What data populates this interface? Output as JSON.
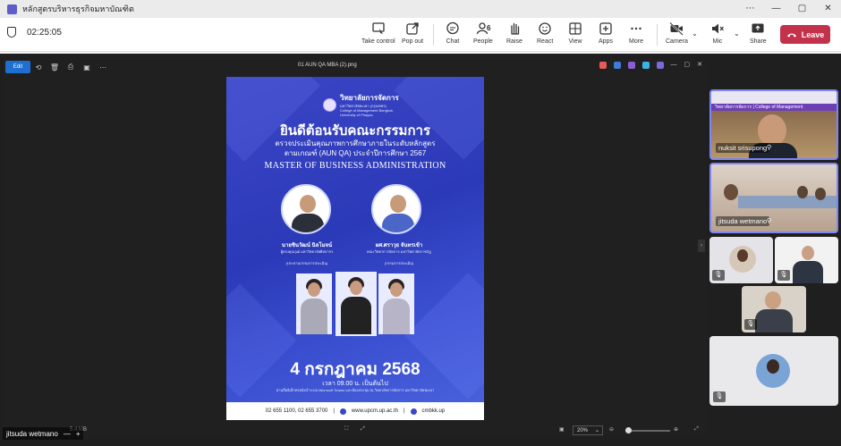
{
  "window": {
    "title": "หลักสูตรบริหารธุรกิจมหาบัณฑิต",
    "controls": [
      "⋯",
      "—",
      "▢",
      "✕"
    ]
  },
  "toolbar": {
    "timer": "02:25:05",
    "buttons": [
      {
        "id": "take-control",
        "label": "Take control",
        "icon": "take-control-icon"
      },
      {
        "id": "pop-out",
        "label": "Pop out",
        "icon": "pop-out-icon"
      },
      {
        "id": "chat",
        "label": "Chat",
        "icon": "chat-icon"
      },
      {
        "id": "people",
        "label": "People",
        "icon": "people-icon",
        "badge": "6"
      },
      {
        "id": "raise",
        "label": "Raise",
        "icon": "hand-icon"
      },
      {
        "id": "react",
        "label": "React",
        "icon": "smile-icon"
      },
      {
        "id": "view",
        "label": "View",
        "icon": "grid-icon"
      },
      {
        "id": "apps",
        "label": "Apps",
        "icon": "plus-square-icon"
      },
      {
        "id": "more",
        "label": "More",
        "icon": "ellipsis-icon"
      },
      {
        "id": "camera",
        "label": "Camera",
        "icon": "camera-off-icon"
      },
      {
        "id": "mic",
        "label": "Mic",
        "icon": "mic-muted-icon"
      },
      {
        "id": "share",
        "label": "Share",
        "icon": "share-icon"
      }
    ],
    "leave_label": "Leave"
  },
  "viewer": {
    "edit_label": "Edit",
    "file_name": "01 AUN QA MBA (2).png",
    "zoom": "20%",
    "file_size": "5.4 MB"
  },
  "poster": {
    "college_th": "วิทยาลัยการจัดการ",
    "college_sub": "มหาวิทยาลัยพะเยา (กรุงเทพฯ)",
    "college_en1": "College of Management Bangkok",
    "college_en2": "University of Phayao",
    "welcome": "ยินดีต้อนรับคณะกรรมการ",
    "sub1": "ตรวจประเมินคุณภาพการศึกษาภายในระดับหลักสูตร",
    "sub2": "ตามเกณฑ์ (AUN QA) ประจำปีการศึกษา 2567",
    "program": "MASTER OF BUSINESS ADMINISTRATION",
    "person1_name": "นายชินวัฒน์ นิลโมจน์",
    "person1_role": "ผู้ทรงคุณวุฒิ มหาวิทยาลัยศิลปากร",
    "person1_title": "(ประธานกรรมการประเมิน)",
    "person2_name": "ผศ.ศราวุธ จันทรเข้า",
    "person2_role": "คณะวิทยาการจัดการ มหาวิทยาลัยราชภัฏ",
    "person2_title": "(กรรมการประเมิน)",
    "date": "4 กรกฎาคม 2568",
    "time": "เวลา 09.00 น. เป็นต้นไป",
    "via": "ผ่านสื่ออิเล็กทรอนิกส์ ระบบ Microsoft Teams และห้องประชุม ณ วิทยาลัยการจัดการ มหาวิทยาลัยพะเยา",
    "phone": "02 655 1100, 02 655 3700",
    "web": "www.upcm.up.ac.th",
    "fb": "cmbkk.up"
  },
  "sharer": "jitsuda wetmano",
  "participants": [
    {
      "name": "nuksit srisupong",
      "banner": "วิทยาลัยการจัดการ | College of Management"
    },
    {
      "name": "jitsuda wetmano"
    }
  ],
  "colors": {
    "accent": "#5b5fc7",
    "leave": "#c4314b",
    "poster": "#2b3ab8"
  }
}
